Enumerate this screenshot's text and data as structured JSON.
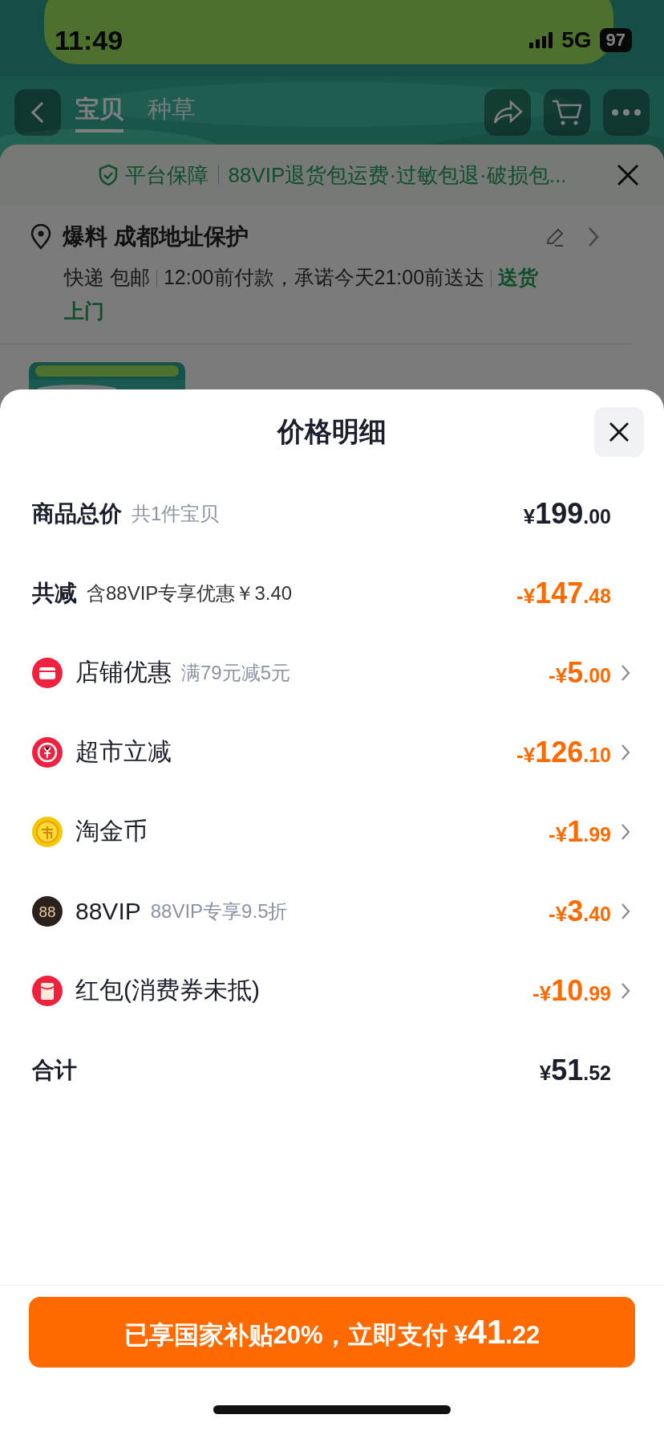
{
  "status_bar": {
    "time": "11:49",
    "network": "5G",
    "battery": "97"
  },
  "tabs": [
    {
      "label": "宝贝",
      "selected": true
    },
    {
      "label": "种草",
      "selected": false
    }
  ],
  "guarantee": {
    "title": "平台保障",
    "text": "88VIP退货包运费·过敏包退·破损包..."
  },
  "address": {
    "title": "爆料 成都地址保护",
    "shipping": "快递 包邮",
    "promise": "12:00前付款，承诺今天21:00前送达",
    "service": "送货上门"
  },
  "sheet": {
    "title": "价格明细"
  },
  "rows": [
    {
      "kind": "total",
      "label": "商品总价",
      "note": "共1件宝贝",
      "amount": "¥199.00"
    },
    {
      "kind": "discount_sum",
      "label": "共减",
      "note": "含88VIP专享优惠￥3.40",
      "amount": "-¥147.48"
    },
    {
      "kind": "store",
      "label": "店铺优惠",
      "note": "满79元减5元",
      "amount": "-¥5.00"
    },
    {
      "kind": "rebate",
      "label": "超市立减",
      "amount": "-¥126.10"
    },
    {
      "kind": "coin",
      "label": "淘金币",
      "amount": "-¥1.99"
    },
    {
      "kind": "vip",
      "icon_text": "88",
      "label": "88VIP",
      "note": "88VIP专享9.5折",
      "amount": "-¥3.40"
    },
    {
      "kind": "redpacket",
      "label": "红包(消费券未抵)",
      "amount": "-¥10.99"
    },
    {
      "kind": "sum",
      "label": "合计",
      "amount": "¥51.52"
    }
  ],
  "pay_button": {
    "label": "已享国家补贴20%，立即支付 ¥",
    "amount": "41.22"
  }
}
